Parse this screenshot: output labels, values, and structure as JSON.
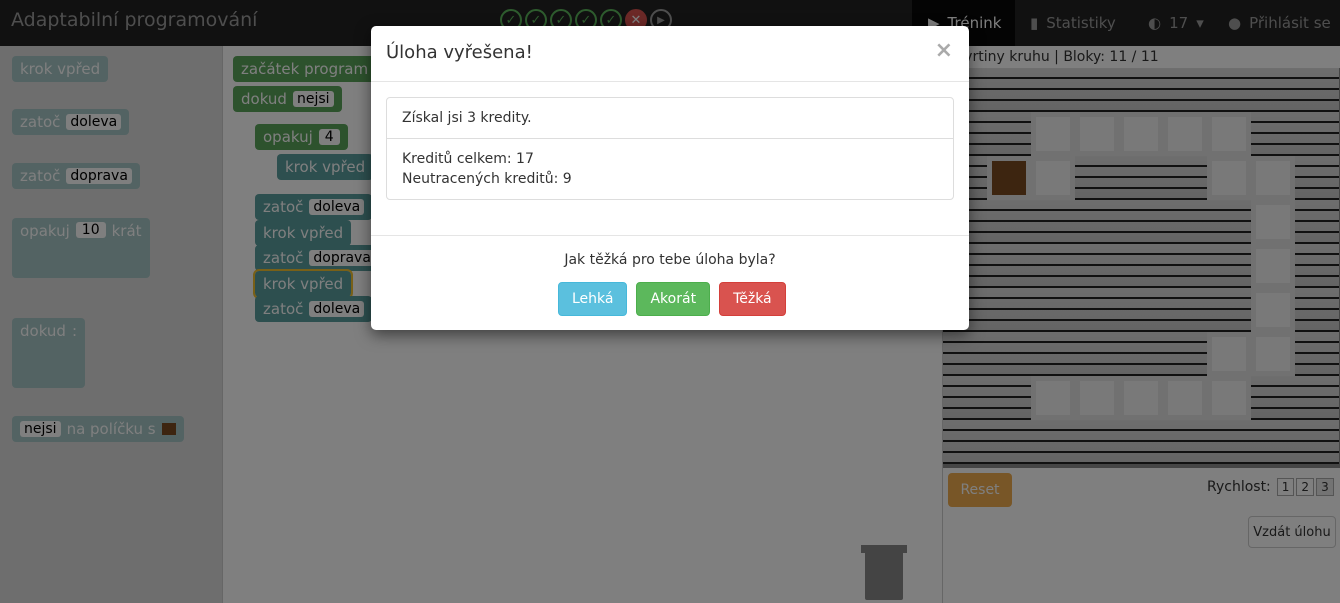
{
  "navbar": {
    "brand": "Adaptabilní programování",
    "progress_icons": [
      "check-icon",
      "check-icon",
      "check-icon",
      "check-icon",
      "check-icon",
      "cross-icon",
      "play-icon"
    ],
    "training": "Trénink",
    "stats": "Statistiky",
    "credits": "17",
    "login": "Přihlásit se"
  },
  "toolbox": {
    "step": "krok vpřed",
    "turn": "zatoč",
    "left": "doleva",
    "right": "doprava",
    "repeat": "opakuj",
    "repeat_num": "10",
    "times": "krát",
    "while": "dokud",
    "colon": ":",
    "nejsi": "nejsi",
    "on_tile": "na políčku s"
  },
  "program": {
    "start": "začátek program",
    "while": "dokud",
    "cond": "nejsi",
    "repeat": "opakuj",
    "repeat_num": "4",
    "lines": [
      {
        "cmd": "krok vpřed",
        "arg": ""
      },
      {
        "cmd": "zatoč",
        "arg": "doleva"
      },
      {
        "cmd": "krok vpřed",
        "arg": ""
      },
      {
        "cmd": "zatoč",
        "arg": "doprava"
      },
      {
        "cmd": "krok vpřed",
        "arg": ""
      },
      {
        "cmd": "zatoč",
        "arg": "doleva"
      }
    ]
  },
  "panel": {
    "task_info": "čtvrtiny kruhu | Bloky: 11 / 11",
    "reset": "Reset",
    "speed_label": "Rychlost:",
    "speeds": [
      "1",
      "2",
      "3"
    ],
    "give_up": "Vzdát úlohu"
  },
  "modal": {
    "title": "Úloha vyřešena!",
    "close": "×",
    "earned": "Získal jsi 3 kredity.",
    "total": "Kreditů celkem: 17",
    "unspent": "Neutracených kreditů: 9",
    "question": "Jak těžká pro tebe úloha byla?",
    "easy": "Lehká",
    "ok": "Akorát",
    "hard": "Těžká"
  },
  "colors": {
    "easy": "#5bc0de",
    "ok": "#5cb85c",
    "hard": "#d9534f",
    "reset": "#f0ad4e"
  }
}
